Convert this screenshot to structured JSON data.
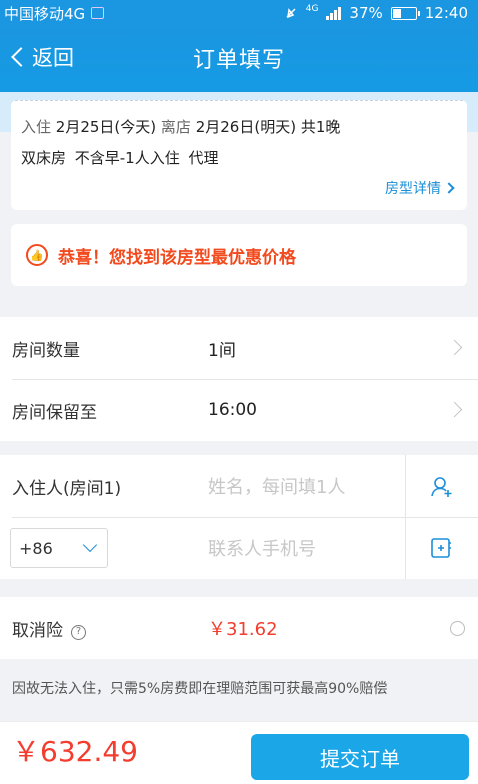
{
  "status_bar": {
    "carrier": "中国移动4G",
    "network": "4G",
    "battery": "37%",
    "time": "12:40"
  },
  "header": {
    "back_label": "返回",
    "title": "订单填写"
  },
  "stay": {
    "checkin_label": "入住",
    "checkin_date": "2月25日(今天)",
    "checkout_label": "离店",
    "checkout_date": "2月26日(明天)",
    "nights": "共1晚",
    "room_desc": "双床房  不含早-1人入住  代理",
    "room_detail_link": "房型详情"
  },
  "promo": {
    "text": "恭喜！您找到该房型最优惠价格"
  },
  "booking": {
    "rooms_label": "房间数量",
    "rooms_value": "1间",
    "hold_label": "房间保留至",
    "hold_value": "16:00"
  },
  "guest": {
    "label": "入住人(房间1)",
    "name_placeholder": "姓名，每间填1人",
    "country_code": "+86",
    "phone_placeholder": "联系人手机号"
  },
  "insurance": {
    "label": "取消险",
    "price": "￥31.62",
    "note": "因故无法入住，只需5%房费即在理赔范围可获最高90%赔偿"
  },
  "footer": {
    "total": "￥632.49",
    "submit_label": "提交订单"
  },
  "colors": {
    "brand_blue": "#1b96e0",
    "accent_red": "#f23d2f",
    "promo_orange": "#f24a1d"
  }
}
